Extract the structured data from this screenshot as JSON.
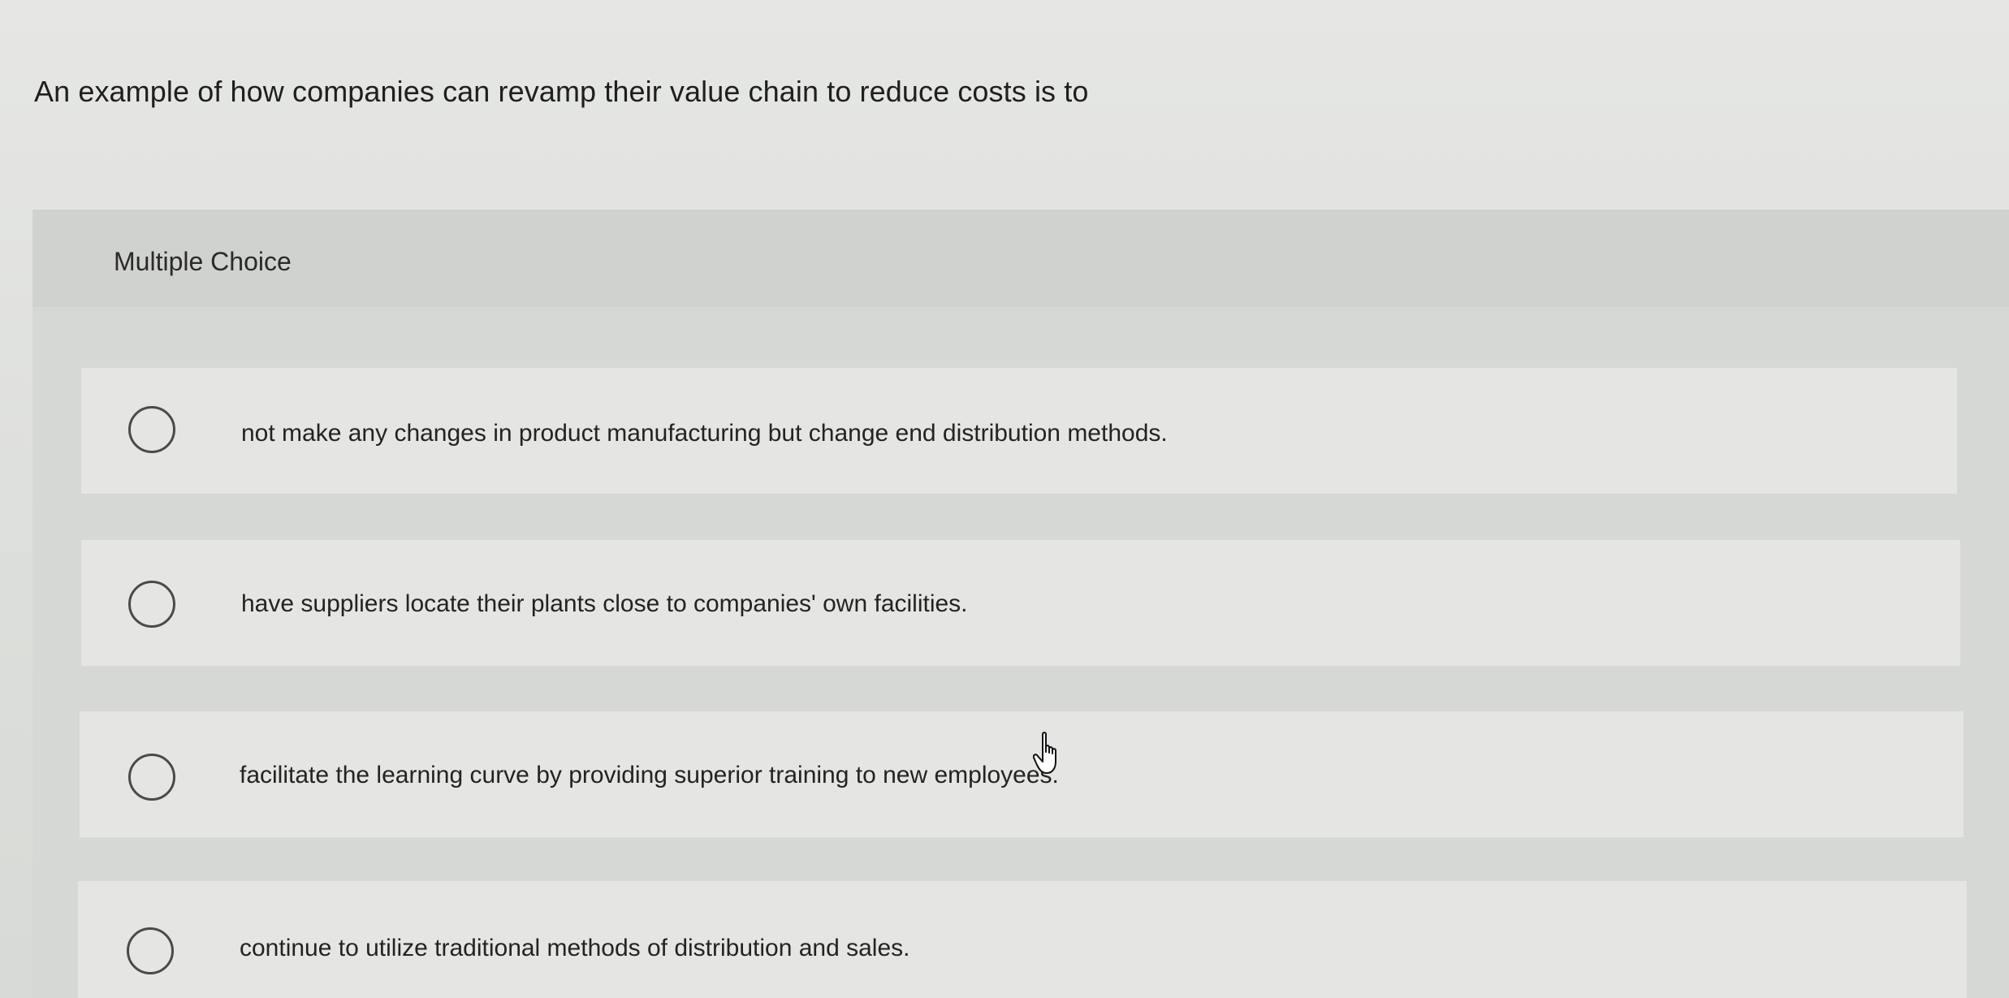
{
  "question": {
    "text": "An example of how companies can revamp their value chain to reduce costs is to"
  },
  "multiple_choice": {
    "header_label": "Multiple Choice",
    "options": [
      {
        "label": "not make any changes in product manufacturing but change end distribution methods.",
        "selected": false
      },
      {
        "label": "have suppliers locate their plants close to companies' own facilities.",
        "selected": false
      },
      {
        "label": "facilitate the learning curve by providing superior training to new employees.",
        "selected": false
      },
      {
        "label": "continue to utilize traditional methods of distribution and sales.",
        "selected": false
      }
    ]
  },
  "icons": {
    "radio": "radio-unselected-icon",
    "cursor": "hand-pointer-cursor-icon"
  }
}
